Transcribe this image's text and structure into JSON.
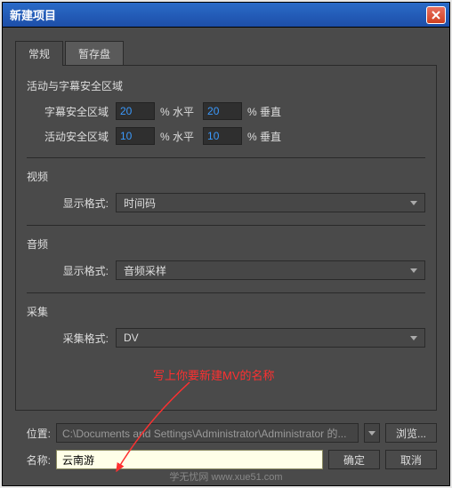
{
  "title": "新建项目",
  "tabs": [
    "常规",
    "暂存盘"
  ],
  "sections": {
    "safe": {
      "title": "活动与字幕安全区域",
      "subtitle_label": "字幕安全区域",
      "subtitle_h": "20",
      "subtitle_v": "20",
      "action_label": "活动安全区域",
      "action_h": "10",
      "action_v": "10",
      "pct_h": "% 水平",
      "pct_v": "% 垂直"
    },
    "video": {
      "title": "视频",
      "format_label": "显示格式:",
      "format_value": "时间码"
    },
    "audio": {
      "title": "音频",
      "format_label": "显示格式:",
      "format_value": "音频采样"
    },
    "capture": {
      "title": "采集",
      "format_label": "采集格式:",
      "format_value": "DV"
    }
  },
  "annotation": "写上你要新建MV的名称",
  "location": {
    "label": "位置:",
    "path": "C:\\Documents and Settings\\Administrator\\Administrator 的...",
    "browse": "浏览..."
  },
  "name": {
    "label": "名称:",
    "value": "云南游"
  },
  "buttons": {
    "ok": "确定",
    "cancel": "取消"
  },
  "watermark": "学无忧网    www.xue51.com"
}
